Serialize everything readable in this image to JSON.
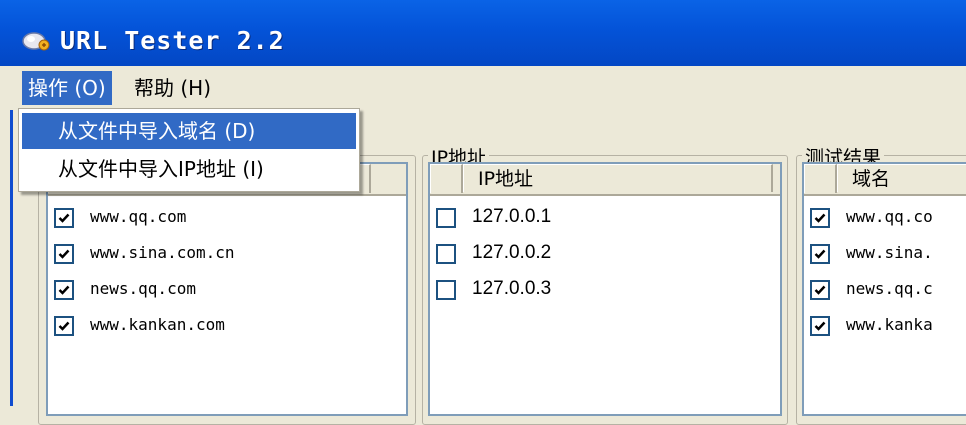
{
  "window": {
    "title": "URL Tester 2.2",
    "icon": "app-icon"
  },
  "menu": {
    "items": [
      {
        "label": "操作 (O)",
        "active": true
      },
      {
        "label": "帮助 (H)",
        "active": false
      }
    ],
    "dropdown": [
      {
        "label": "从文件中导入域名 (D)",
        "highlighted": true
      },
      {
        "label": "从文件中导入IP地址 (I)",
        "highlighted": false
      }
    ]
  },
  "panels": {
    "domains": {
      "rows": [
        {
          "text": "www.qq.com",
          "checked": true
        },
        {
          "text": "www.sina.com.cn",
          "checked": true
        },
        {
          "text": "news.qq.com",
          "checked": true
        },
        {
          "text": "www.kankan.com",
          "checked": true
        }
      ]
    },
    "ips": {
      "title": "IP地址",
      "column": "IP地址",
      "rows": [
        {
          "text": "127.0.0.1",
          "checked": false
        },
        {
          "text": "127.0.0.2",
          "checked": false
        },
        {
          "text": "127.0.0.3",
          "checked": false
        }
      ]
    },
    "results": {
      "title": "测试结果",
      "column": "域名",
      "rows": [
        {
          "text": "www.qq.co",
          "checked": true
        },
        {
          "text": "www.sina.",
          "checked": true
        },
        {
          "text": "news.qq.c",
          "checked": true
        },
        {
          "text": "www.kanka",
          "checked": true
        }
      ]
    }
  },
  "colors": {
    "titlebar": "#0453d8",
    "highlight": "#316ac5",
    "face": "#ece9d8",
    "check_border": "#1c5180"
  }
}
